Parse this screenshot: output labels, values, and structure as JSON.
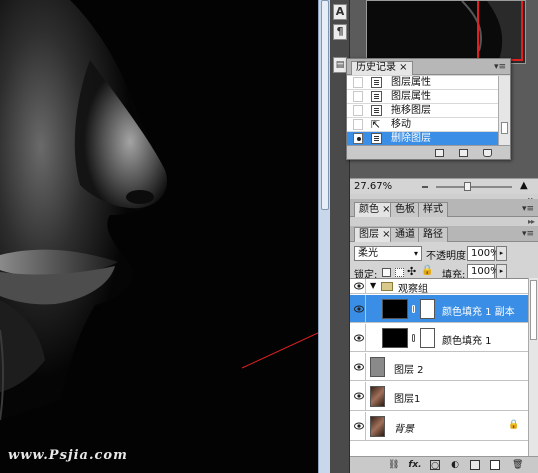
{
  "watermark": "www.Psjia.com",
  "dock": {
    "buttons": [
      "A",
      "¶",
      "▤"
    ]
  },
  "navigator": {
    "zoom": "27.67%"
  },
  "history": {
    "tab": "历史记录",
    "items": [
      {
        "label": "图层属性",
        "icon": "layer-properties-icon"
      },
      {
        "label": "图层属性",
        "icon": "layer-properties-icon"
      },
      {
        "label": "拖移图层",
        "icon": "layer-drag-icon"
      },
      {
        "label": "移动",
        "icon": "move-tool-icon"
      },
      {
        "label": "删除图层",
        "icon": "delete-layer-icon",
        "selected": true
      }
    ]
  },
  "color_panel": {
    "tabs": [
      "颜色",
      "色板",
      "样式"
    ]
  },
  "layers_panel": {
    "tabs": [
      "图层",
      "通道",
      "路径"
    ],
    "blend_mode": "柔光",
    "opacity_label": "不透明度:",
    "opacity": "100%",
    "lock_label": "锁定:",
    "fill_label": "填充:",
    "fill": "100%",
    "layers": [
      {
        "name": "观察组",
        "type": "group"
      },
      {
        "name": "颜色填充 1 副本",
        "type": "fill",
        "selected": true
      },
      {
        "name": "颜色填充 1",
        "type": "fill"
      },
      {
        "name": "图层 2",
        "type": "gray"
      },
      {
        "name": "图层1",
        "type": "photo"
      },
      {
        "name": "背景",
        "type": "background"
      }
    ]
  },
  "colors": {
    "selection": "#3a8ee6",
    "arrow": "#e02020",
    "panel_bg": "#d4d4d4"
  }
}
